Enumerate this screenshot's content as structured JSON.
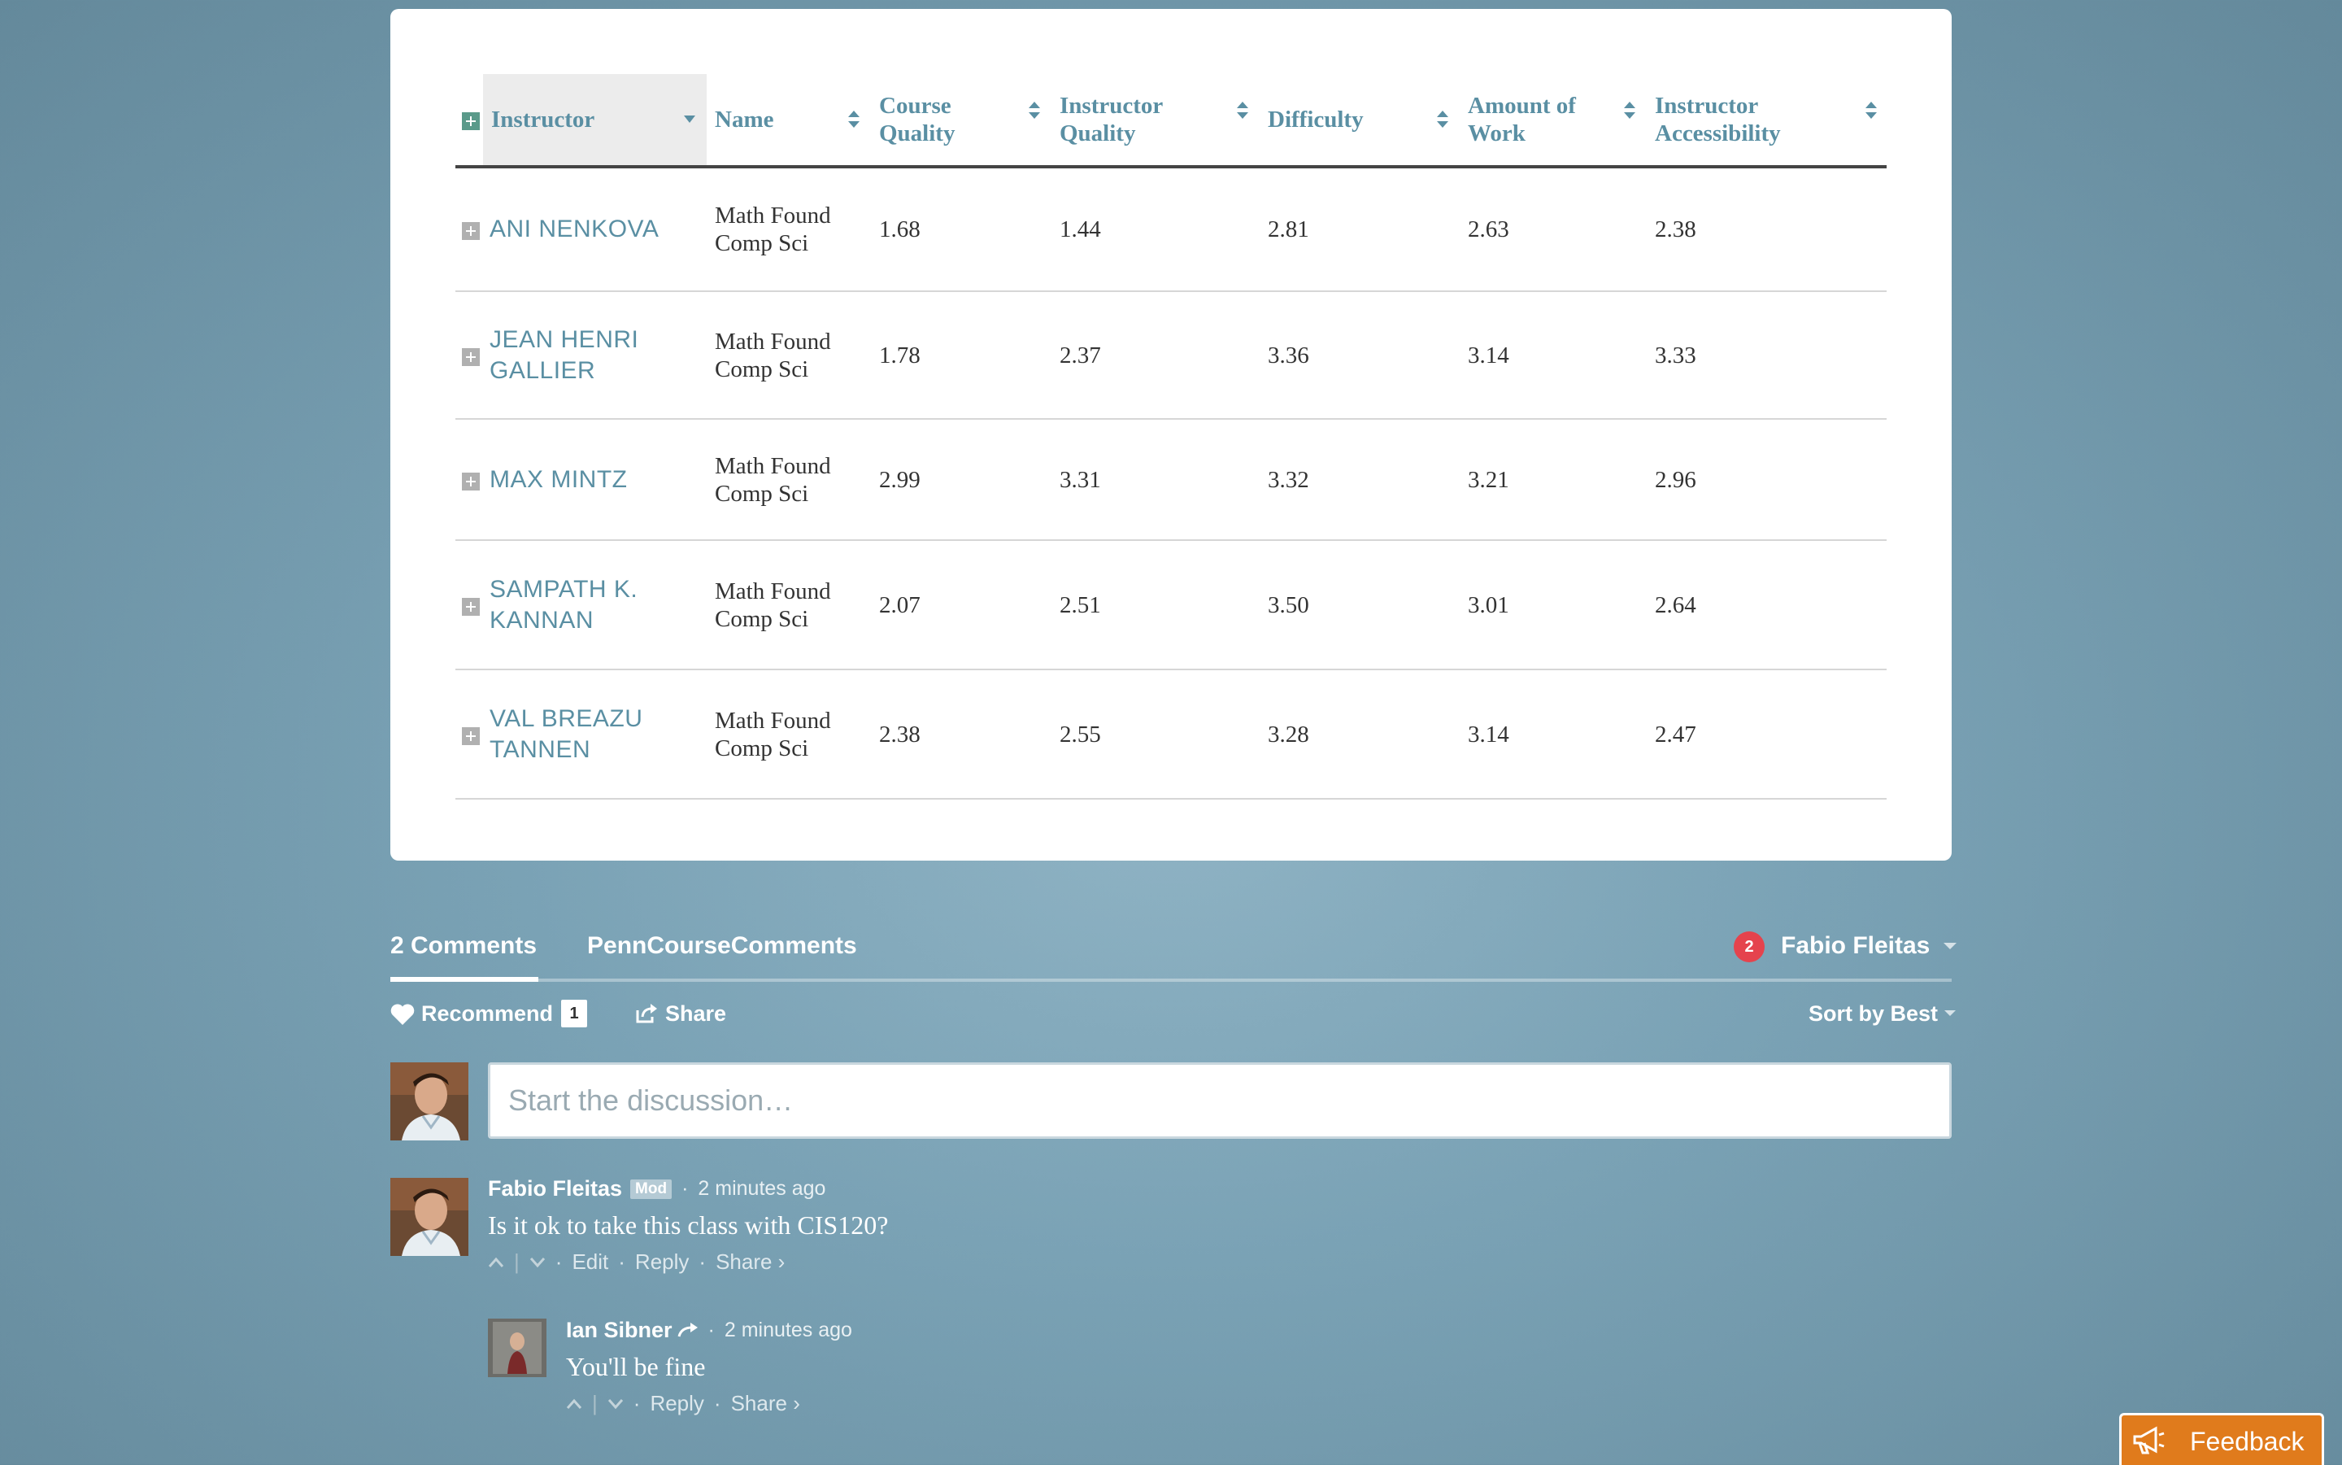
{
  "table": {
    "headers": {
      "instructor": "Instructor",
      "name": "Name",
      "course_quality": "Course Quality",
      "instructor_quality": "Instructor Quality",
      "difficulty": "Difficulty",
      "amount_of_work": "Amount of Work",
      "instructor_accessibility": "Instructor Accessibility"
    },
    "rows": [
      {
        "instructor": "ANI NENKOVA",
        "name": "Math Found Comp Sci",
        "course_quality": "1.68",
        "instructor_quality": "1.44",
        "difficulty": "2.81",
        "amount_of_work": "2.63",
        "instructor_accessibility": "2.38"
      },
      {
        "instructor": "JEAN HENRI GALLIER",
        "name": "Math Found Comp Sci",
        "course_quality": "1.78",
        "instructor_quality": "2.37",
        "difficulty": "3.36",
        "amount_of_work": "3.14",
        "instructor_accessibility": "3.33"
      },
      {
        "instructor": "MAX MINTZ",
        "name": "Math Found Comp Sci",
        "course_quality": "2.99",
        "instructor_quality": "3.31",
        "difficulty": "3.32",
        "amount_of_work": "3.21",
        "instructor_accessibility": "2.96"
      },
      {
        "instructor": "SAMPATH K. KANNAN",
        "name": "Math Found Comp Sci",
        "course_quality": "2.07",
        "instructor_quality": "2.51",
        "difficulty": "3.50",
        "amount_of_work": "3.01",
        "instructor_accessibility": "2.64"
      },
      {
        "instructor": "VAL BREAZU TANNEN",
        "name": "Math Found Comp Sci",
        "course_quality": "2.38",
        "instructor_quality": "2.55",
        "difficulty": "3.28",
        "amount_of_work": "3.14",
        "instructor_accessibility": "2.47"
      }
    ]
  },
  "comments_nav": {
    "count_tab": "2 Comments",
    "community_tab": "PennCourseComments",
    "notification_count": "2",
    "user_name": "Fabio Fleitas",
    "recommend_label": "Recommend",
    "recommend_count": "1",
    "share_label": "Share",
    "sort_label": "Sort by Best"
  },
  "composer": {
    "placeholder": "Start the discussion…"
  },
  "comments": [
    {
      "author": "Fabio Fleitas",
      "badge": "Mod",
      "time": "2 minutes ago",
      "text": "Is it ok to take this class with CIS120?",
      "actions": {
        "edit": "Edit",
        "reply": "Reply",
        "share": "Share ›"
      }
    },
    {
      "author": "Ian Sibner",
      "time": "2 minutes ago",
      "text": "You'll be fine",
      "actions": {
        "reply": "Reply",
        "share": "Share ›"
      }
    }
  ],
  "feedback_label": "Feedback",
  "colors": {
    "accent": "#5a8fa3",
    "notification": "#e5434d",
    "feedback": "#e07b1c"
  }
}
